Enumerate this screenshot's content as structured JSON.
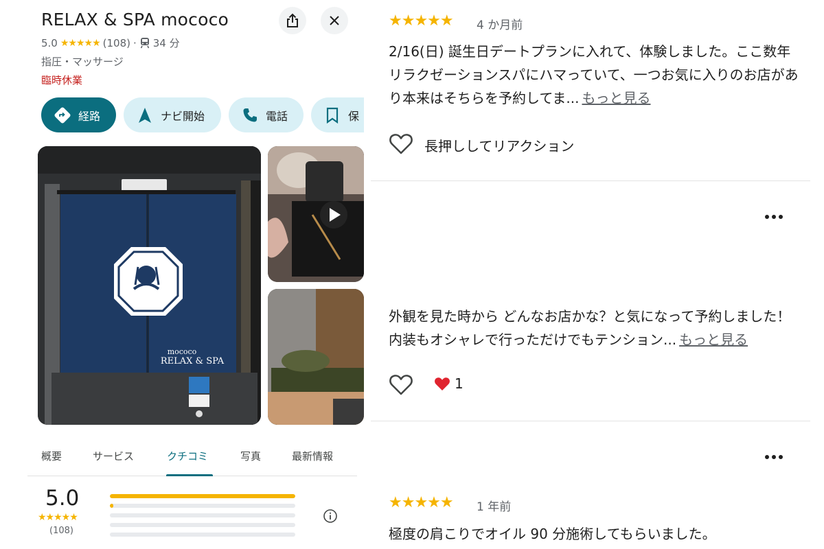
{
  "place": {
    "name": "RELAX & SPA mococo",
    "rating": "5.0",
    "stars": "★★★★★",
    "review_count": "(108)",
    "separator": "·",
    "transit_time": "34 分",
    "category": "指圧・マッサージ",
    "status": "臨時休業"
  },
  "actions": [
    {
      "label": "経路"
    },
    {
      "label": "ナビ開始"
    },
    {
      "label": "電話"
    },
    {
      "label": "保"
    }
  ],
  "photos": {
    "curtain_brand": "mococo",
    "curtain_title": "RELAX & SPA"
  },
  "tabs": [
    {
      "label": "概要"
    },
    {
      "label": "サービス"
    },
    {
      "label": "クチコミ"
    },
    {
      "label": "写真"
    },
    {
      "label": "最新情報"
    }
  ],
  "summary": {
    "rating": "5.0",
    "stars": "★★★★★",
    "count": "(108)",
    "distribution": [
      1.0,
      0.02,
      0.0,
      0.0,
      0.0
    ]
  },
  "reviews": [
    {
      "stars": "★★★★★",
      "age": "4 か月前",
      "text": "2/16(日) 誕生日デートプランに入れて、体験しました。ここ数年リラクゼーションスパにハマっていて、一つお気に入りのお店があり本来はそちらを予約してま...",
      "more": "もっと見る",
      "reaction_label": "長押ししてリアクション"
    },
    {
      "text": "外観を見た時から どんなお店かな？と気になって予約しました！\n内装もオシャレで行っただけでもテンション...",
      "more": "もっと見る",
      "reaction_count": "1"
    },
    {
      "stars": "★★★★★",
      "age": "1 年前",
      "text": "極度の肩こりでオイル 90 分施術してもらいました。"
    }
  ],
  "colors": {
    "accent": "#0b6e7f",
    "chip_bg": "#d9f0f6",
    "star": "#f5b400",
    "closed": "#c5221f"
  }
}
